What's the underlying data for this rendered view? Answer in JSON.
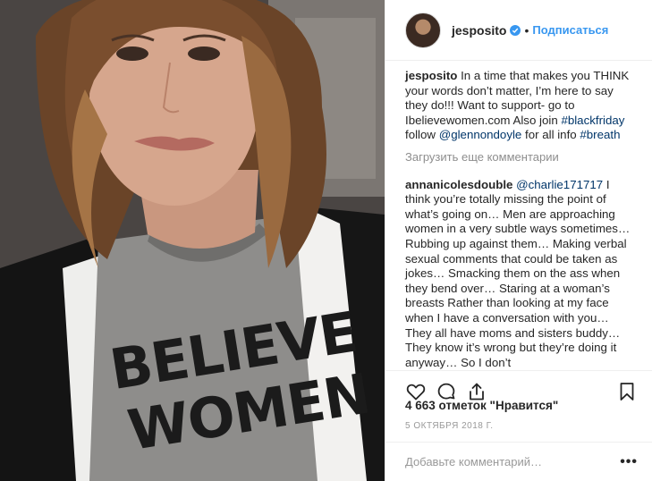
{
  "post": {
    "shirt_line1": "BELIEVE",
    "shirt_line2": "WOMEN"
  },
  "header": {
    "username": "jesposito",
    "verified_icon": "verified-badge-icon",
    "separator": "•",
    "follow_label": "Подписаться"
  },
  "caption": {
    "username": "jesposito",
    "text_1": "In a time that makes you THINK your words don’t matter, I’m here to say they do!!! Want to support- go to Ibelievewomen.com Also join ",
    "hashtag_1": "#blackfriday",
    "text_2": " follow ",
    "mention": "@glennondoyle",
    "text_3": " for all info ",
    "hashtag_2": "#breath"
  },
  "load_more_label": "Загрузить еще комментарии",
  "comment": {
    "username": "annanicolesdouble",
    "mention": "@charlie171717",
    "text": " I think you’re totally missing the point of what’s going on… Men are approaching women in a very subtle ways sometimes… Rubbing up against them… Making verbal sexual comments that could be taken as jokes… Smacking them on the ass when they bend over… Staring at a woman’s breasts Rather than looking at my face when I have a conversation with you… They all have moms and sisters buddy… They know it’s wrong but they’re doing it anyway… So I don’t"
  },
  "actions": {
    "like_icon": "heart-icon",
    "comment_icon": "comment-bubble-icon",
    "share_icon": "share-icon",
    "save_icon": "bookmark-icon"
  },
  "likes_text": "4 663 отметок \"Нравится\"",
  "date_text": "5 ОКТЯБРЯ 2018 Г.",
  "add_comment": {
    "placeholder": "Добавьте комментарий…",
    "more_label": "•••"
  },
  "colors": {
    "link": "#003569",
    "accent": "#3897f0",
    "muted": "#999999"
  }
}
